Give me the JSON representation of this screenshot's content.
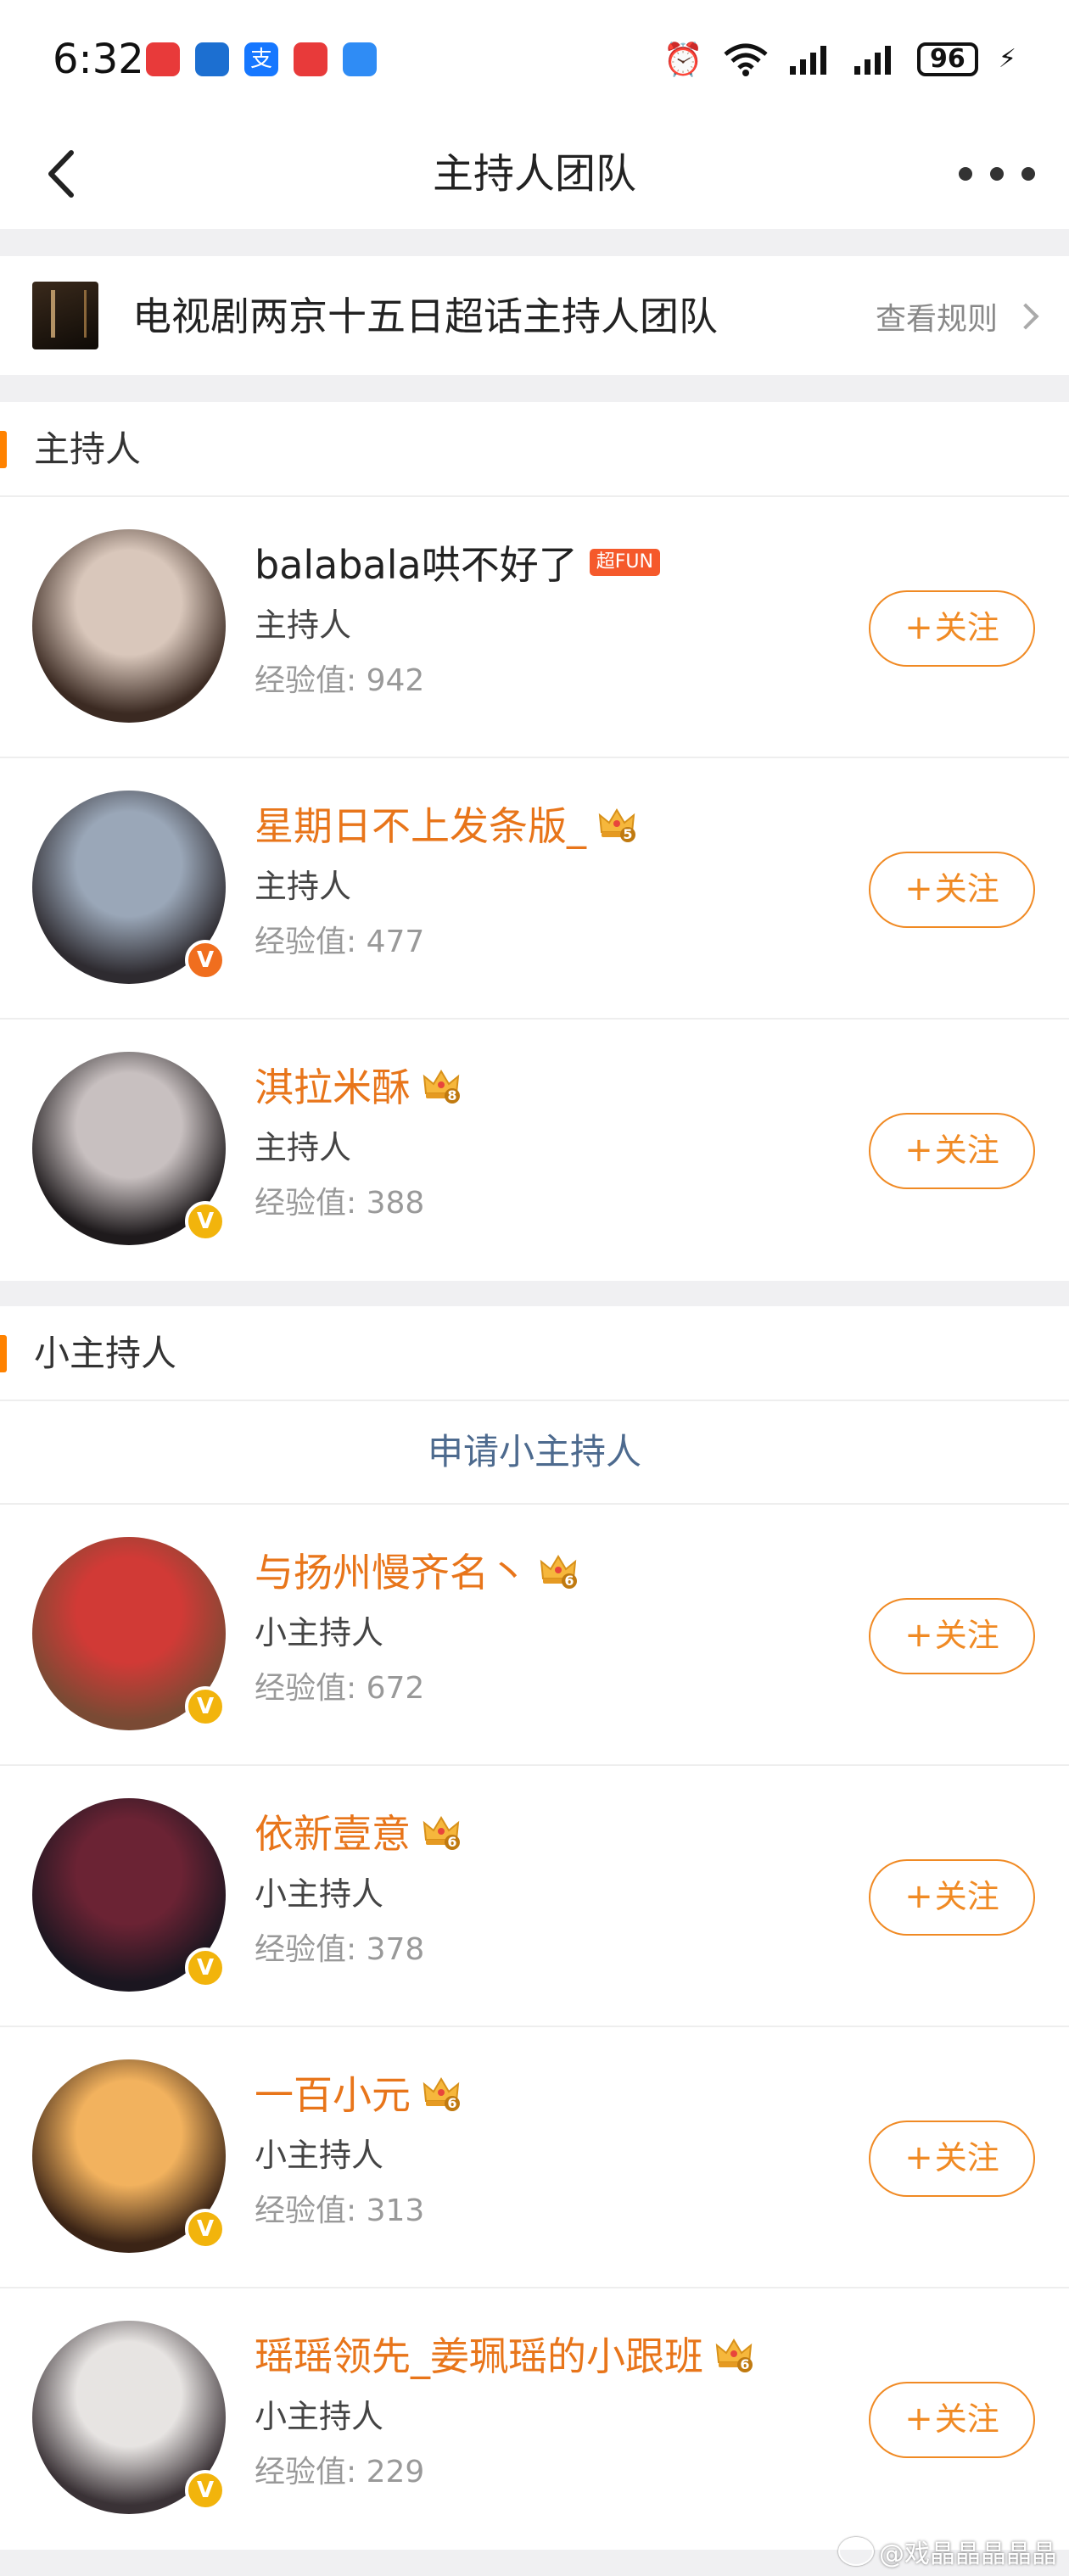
{
  "status_bar": {
    "time": "6:32",
    "battery": "96",
    "app_icons": [
      {
        "name": "huawei-mall-app-icon",
        "color": "#e83a3a"
      },
      {
        "name": "bank-app-icon",
        "color": "#1c6fd1"
      },
      {
        "name": "alipay-app-icon",
        "color": "#1677ff"
      },
      {
        "name": "huawei-mall-app-icon",
        "color": "#e83a3a"
      },
      {
        "name": "weather-app-icon",
        "color": "#2f8cf5"
      }
    ]
  },
  "nav": {
    "title": "主持人团队"
  },
  "topic": {
    "name": "电视剧两京十五日超话主持人团队",
    "rules_label": "查看规则"
  },
  "sections": {
    "hosts_label": "主持人",
    "junior_label": "小主持人",
    "apply_label": "申请小主持人"
  },
  "follow_label": "关注",
  "exp_prefix": "经验值: ",
  "hosts": [
    {
      "name": "balabala哄不好了",
      "name_color": "dark",
      "badge": "超FUN",
      "role": "主持人",
      "exp": "经验值: 942",
      "verified": "none",
      "avatar_colors": [
        "#d9c7bb",
        "#3b2a22"
      ]
    },
    {
      "name": "星期日不上发条版_",
      "name_color": "orange",
      "crown_level": "5",
      "role": "主持人",
      "exp": "经验值: 477",
      "verified": "orange",
      "avatar_colors": [
        "#9aa7b8",
        "#2e2b30"
      ]
    },
    {
      "name": "淇拉米酥",
      "name_color": "orange",
      "crown_level": "8",
      "role": "主持人",
      "exp": "经验值: 388",
      "verified": "gold",
      "avatar_colors": [
        "#c8c0c0",
        "#1e1a1c"
      ]
    }
  ],
  "junior_hosts": [
    {
      "name": "与扬州慢齐名丶",
      "name_color": "orange",
      "crown_level": "6",
      "role": "小主持人",
      "exp": "经验值: 672",
      "verified": "gold",
      "avatar_colors": [
        "#d13a36",
        "#7a4a34"
      ]
    },
    {
      "name": "依新壹意",
      "name_color": "orange",
      "crown_level": "6",
      "role": "小主持人",
      "exp": "经验值: 378",
      "verified": "gold",
      "avatar_colors": [
        "#6b2334",
        "#1b1620"
      ]
    },
    {
      "name": "一百小元",
      "name_color": "orange",
      "crown_level": "6",
      "role": "小主持人",
      "exp": "经验值: 313",
      "verified": "gold",
      "avatar_colors": [
        "#f2b25e",
        "#3b2416"
      ]
    },
    {
      "name": "瑶瑶领先_姜珮瑶的小跟班",
      "name_color": "orange",
      "crown_level": "6",
      "role": "小主持人",
      "exp": "经验值: 229",
      "verified": "gold",
      "avatar_colors": [
        "#e7e4e2",
        "#3a3236"
      ]
    }
  ],
  "watermark": "@戏晶晶晶晶晶"
}
